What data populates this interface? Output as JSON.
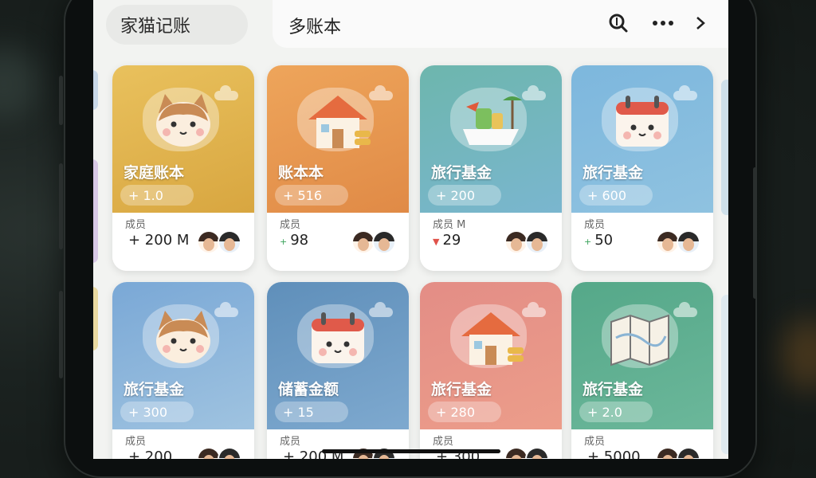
{
  "app": {
    "title": "家猫记账"
  },
  "header": {
    "tab_title": "多账本"
  },
  "icons": {
    "search": "search-icon",
    "more": "more-icon",
    "next": "chevron-right-icon"
  },
  "colors": {
    "gold": "#e2b24c",
    "orange": "#e6964f",
    "teal": "#5fa7a1",
    "sky": "#7cb2d8"
  },
  "cards": [
    {
      "name": "家庭账本",
      "amount": "+ 1.0",
      "member_label": "成员",
      "member_count": "+ 200 M",
      "trend": "",
      "theme": "gold",
      "illustration": "cat-icon"
    },
    {
      "name": "账本本",
      "amount": "+ 516",
      "member_label": "成员",
      "member_count": "98",
      "trend": "+",
      "theme": "orange",
      "illustration": "house-icon"
    },
    {
      "name": "旅行基金",
      "amount": "+ 200",
      "member_label": "成员 M",
      "member_count": "29",
      "trend": "▼",
      "theme": "teal",
      "illustration": "boat-icon"
    },
    {
      "name": "旅行基金",
      "amount": "+ 600",
      "member_label": "成员",
      "member_count": "50",
      "trend": "+",
      "theme": "sky",
      "illustration": "calendar-cat-icon"
    },
    {
      "name": "旅行基金",
      "amount": "+ 300",
      "member_label": "成员",
      "member_count": "+ 200",
      "trend": "",
      "theme": "blue",
      "illustration": "cat-icon"
    },
    {
      "name": "储蓄金额",
      "amount": "+ 15",
      "member_label": "成员",
      "member_count": "+ 200 M",
      "trend": "",
      "theme": "steel",
      "illustration": "calendar-cat-icon"
    },
    {
      "name": "旅行基金",
      "amount": "+ 280",
      "member_label": "成员",
      "member_count": "+ 300",
      "trend": "",
      "theme": "coral",
      "illustration": "house-icon"
    },
    {
      "name": "旅行基金",
      "amount": "+ 2.0",
      "member_label": "成员",
      "member_count": "+ 5000",
      "trend": "",
      "theme": "green",
      "illustration": "map-icon"
    }
  ]
}
